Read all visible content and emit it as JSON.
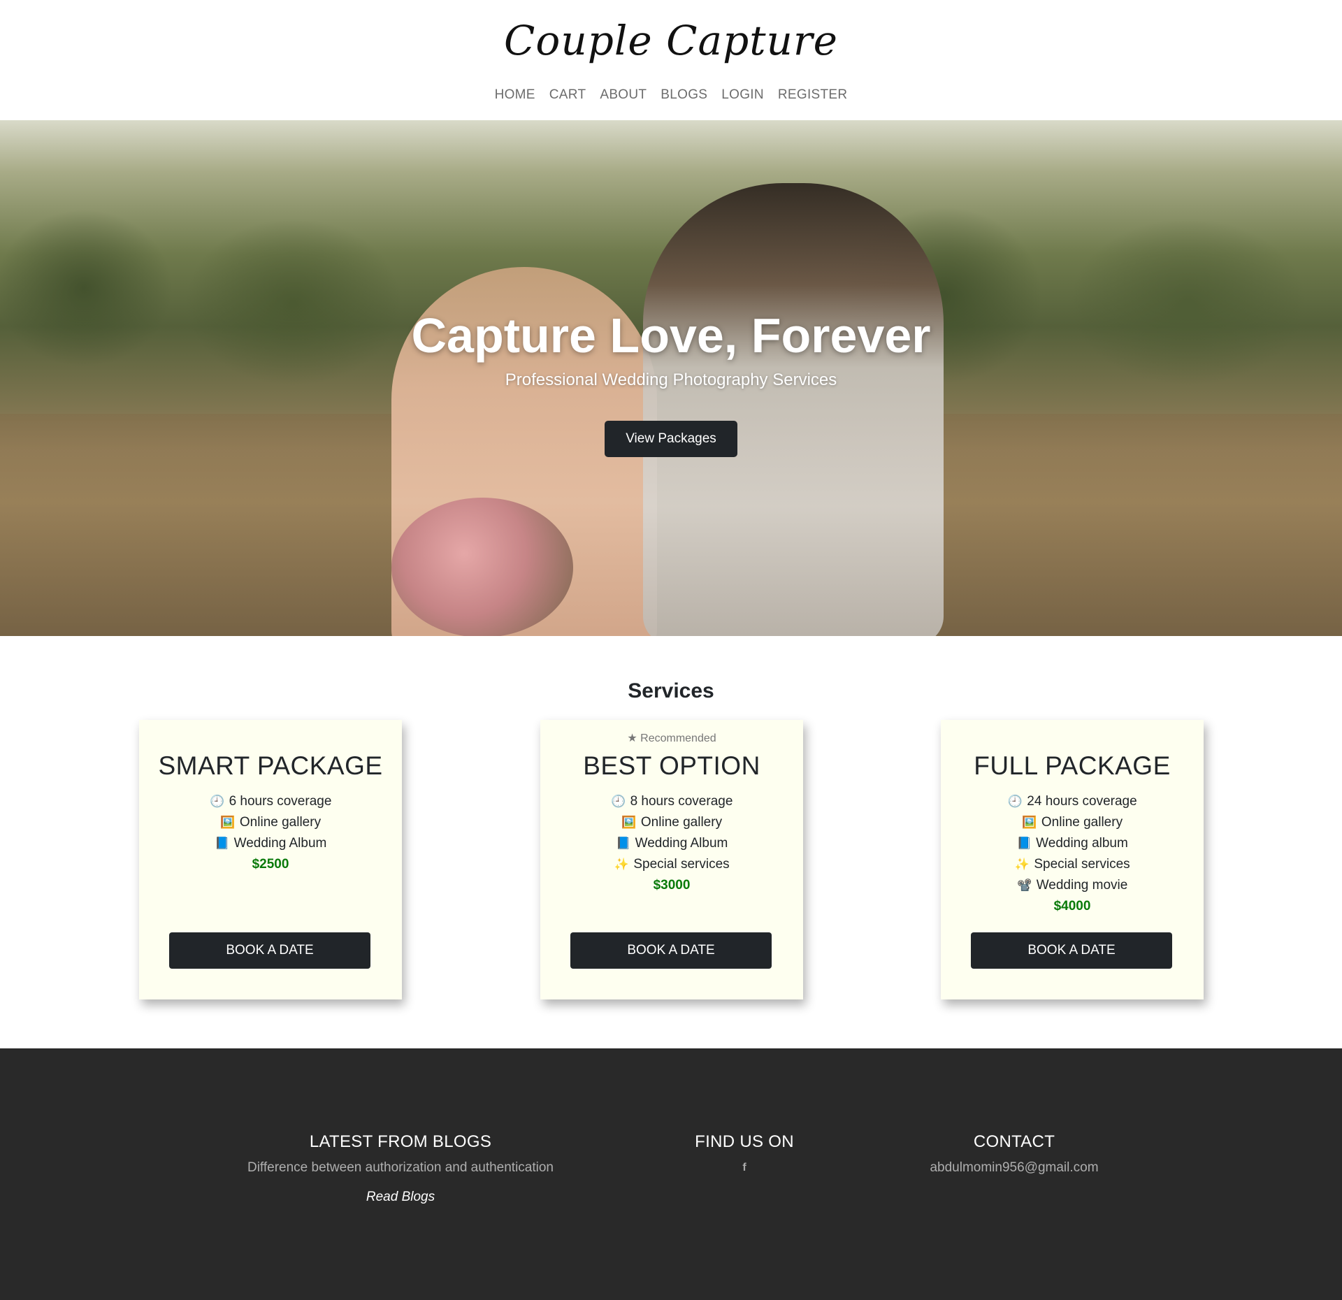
{
  "header": {
    "brand": "Couple Capture",
    "nav": [
      "HOME",
      "CART",
      "ABOUT",
      "BLOGS",
      "LOGIN",
      "REGISTER"
    ]
  },
  "hero": {
    "title": "Capture Love, Forever",
    "subtitle": "Professional Wedding Photography Services",
    "button": "View Packages"
  },
  "services": {
    "title": "Services",
    "cards": [
      {
        "badge": "",
        "name": "SMART PACKAGE",
        "features": [
          {
            "icon": "clock-icon",
            "text": "6 hours coverage"
          },
          {
            "icon": "picture-icon",
            "text": "Online gallery"
          },
          {
            "icon": "book-icon",
            "text": "Wedding Album"
          }
        ],
        "price": "$2500",
        "button": "BOOK A DATE"
      },
      {
        "badge": "★ Recommended",
        "name": "BEST OPTION",
        "features": [
          {
            "icon": "clock-icon",
            "text": "8 hours coverage"
          },
          {
            "icon": "picture-icon",
            "text": "Online gallery"
          },
          {
            "icon": "book-icon",
            "text": "Wedding Album"
          },
          {
            "icon": "sparkles-icon",
            "text": "Special services"
          }
        ],
        "price": "$3000",
        "button": "BOOK A DATE"
      },
      {
        "badge": "",
        "name": "FULL PACKAGE",
        "features": [
          {
            "icon": "clock-icon",
            "text": "24 hours coverage"
          },
          {
            "icon": "picture-icon",
            "text": "Online gallery"
          },
          {
            "icon": "book-icon",
            "text": "Wedding album"
          },
          {
            "icon": "sparkles-icon",
            "text": "Special services"
          },
          {
            "icon": "film-camera-icon",
            "text": "Wedding movie"
          }
        ],
        "price": "$4000",
        "button": "BOOK A DATE"
      }
    ]
  },
  "footer": {
    "blogs": {
      "heading": "LATEST FROM BLOGS",
      "post": "Difference between authorization and authentication",
      "link": "Read Blogs"
    },
    "social": {
      "heading": "FIND US ON",
      "icon": "facebook-icon",
      "glyph": "f"
    },
    "contact": {
      "heading": "CONTACT",
      "email": "abdulmomin956@gmail.com"
    }
  },
  "colors": {
    "dark": "#212529",
    "price": "#0a7a0a",
    "card_bg": "#fefff0",
    "footer_bg": "#292929"
  }
}
